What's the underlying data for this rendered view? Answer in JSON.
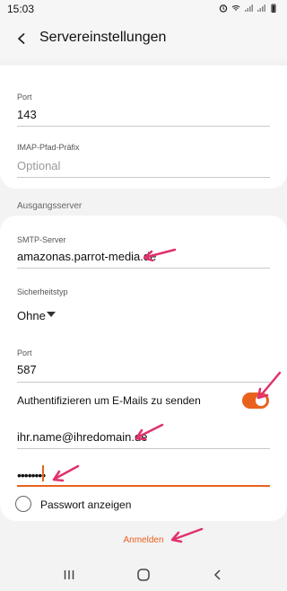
{
  "status_bar": {
    "time": "15:03"
  },
  "header": {
    "title": "Servereinstellungen"
  },
  "incoming": {
    "port_label": "Port",
    "port_value": "143",
    "imap_prefix_label": "IMAP-Pfad-Präfix",
    "imap_prefix_placeholder": "Optional"
  },
  "outgoing": {
    "section_label": "Ausgangsserver",
    "smtp_label": "SMTP-Server",
    "smtp_value": "amazonas.parrot-media.de",
    "security_label": "Sicherheitstyp",
    "security_value": "Ohne",
    "port_label": "Port",
    "port_value": "587",
    "auth_label": "Authentifizieren um E-Mails zu senden",
    "auth_enabled": true,
    "username_value": "ihr.name@ihredomain.de",
    "password_value": "••••••••",
    "show_password_label": "Passwort anzeigen"
  },
  "actions": {
    "login_label": "Anmelden"
  },
  "colors": {
    "accent": "#e8621e",
    "annotation_arrow": "#e0316e"
  },
  "icons": {
    "back": "back-arrow-icon",
    "nav_recents": "recents-icon",
    "nav_home": "home-icon",
    "nav_back": "nav-back-icon"
  }
}
